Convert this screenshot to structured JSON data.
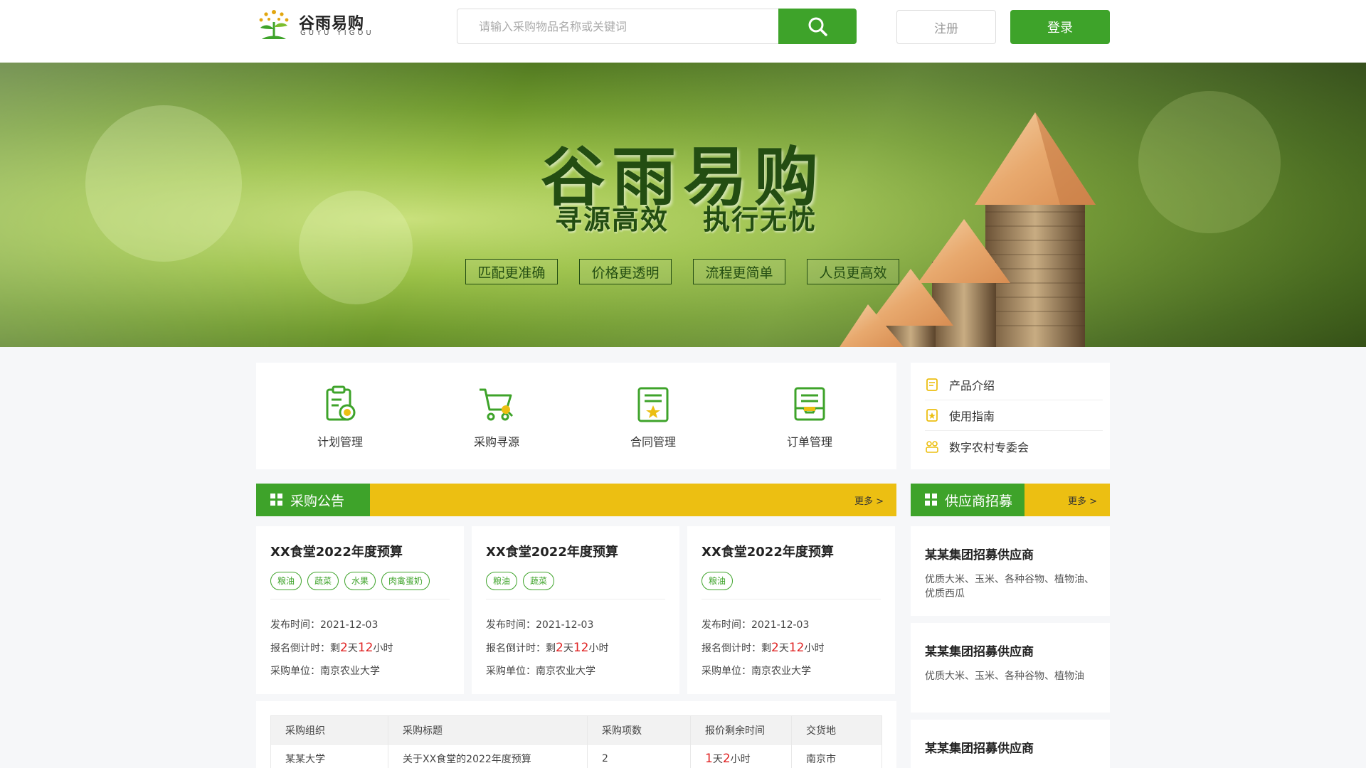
{
  "header": {
    "logo_cn": "谷雨易购",
    "logo_en": "GUYU YIGOU",
    "search_placeholder": "请输入采购物品名称或关键词",
    "register_label": "注册",
    "login_label": "登录"
  },
  "banner": {
    "title": "谷雨易购",
    "subtitle_1": "寻源高效",
    "subtitle_2": "执行无忧",
    "taglines": [
      "匹配更准确",
      "价格更透明",
      "流程更简单",
      "人员更高效"
    ]
  },
  "quick_menu": [
    {
      "label": "计划管理",
      "icon": "plan-clipboard-icon"
    },
    {
      "label": "采购寻源",
      "icon": "cart-search-icon"
    },
    {
      "label": "合同管理",
      "icon": "contract-document-icon"
    },
    {
      "label": "订单管理",
      "icon": "order-inbox-icon"
    }
  ],
  "side_links": [
    {
      "label": "产品介绍",
      "icon": "document-icon"
    },
    {
      "label": "使用指南",
      "icon": "guide-icon"
    },
    {
      "label": "数字农村专委会",
      "icon": "group-icon"
    }
  ],
  "announcements": {
    "title": "采购公告",
    "more": "更多 >",
    "cards": [
      {
        "title": "XX食堂2022年度预算",
        "tags": [
          "粮油",
          "蔬菜",
          "水果",
          "肉禽蛋奶"
        ],
        "publish_label": "发布时间：",
        "publish_date": "2021-12-03",
        "countdown_label": "报名倒计时：",
        "remain": "剩",
        "days": "2",
        "day_unit": "天",
        "hours": "12",
        "hour_unit": "小时",
        "unit_label": "采购单位：",
        "unit": "南京农业大学"
      },
      {
        "title": "XX食堂2022年度预算",
        "tags": [
          "粮油",
          "蔬菜"
        ],
        "publish_label": "发布时间：",
        "publish_date": "2021-12-03",
        "countdown_label": "报名倒计时：",
        "remain": "剩",
        "days": "2",
        "day_unit": "天",
        "hours": "12",
        "hour_unit": "小时",
        "unit_label": "采购单位：",
        "unit": "南京农业大学"
      },
      {
        "title": "XX食堂2022年度预算",
        "tags": [
          "粮油"
        ],
        "publish_label": "发布时间：",
        "publish_date": "2021-12-03",
        "countdown_label": "报名倒计时：",
        "remain": "剩",
        "days": "2",
        "day_unit": "天",
        "hours": "12",
        "hour_unit": "小时",
        "unit_label": "采购单位：",
        "unit": "南京农业大学"
      }
    ]
  },
  "suppliers": {
    "title": "供应商招募",
    "more": "更多 >",
    "cards": [
      {
        "title": "某某集团招募供应商",
        "desc": "优质大米、玉米、各种谷物、植物油、优质西瓜"
      },
      {
        "title": "某某集团招募供应商",
        "desc": "优质大米、玉米、各种谷物、植物油"
      },
      {
        "title": "某某集团招募供应商",
        "desc": ""
      }
    ]
  },
  "table": {
    "headers": [
      "采购组织",
      "采购标题",
      "采购项数",
      "报价剩余时间",
      "交货地"
    ],
    "rows": [
      {
        "org": "某某大学",
        "title": "关于XX食堂的2022年度预算",
        "count": "2",
        "days": "1",
        "day_unit": "天",
        "hours": "2",
        "hour_unit": "小时",
        "place": "南京市"
      }
    ]
  },
  "colors": {
    "brand_green": "#3ea32a",
    "accent_yellow": "#ecbf12",
    "countdown_red": "#e02424"
  }
}
